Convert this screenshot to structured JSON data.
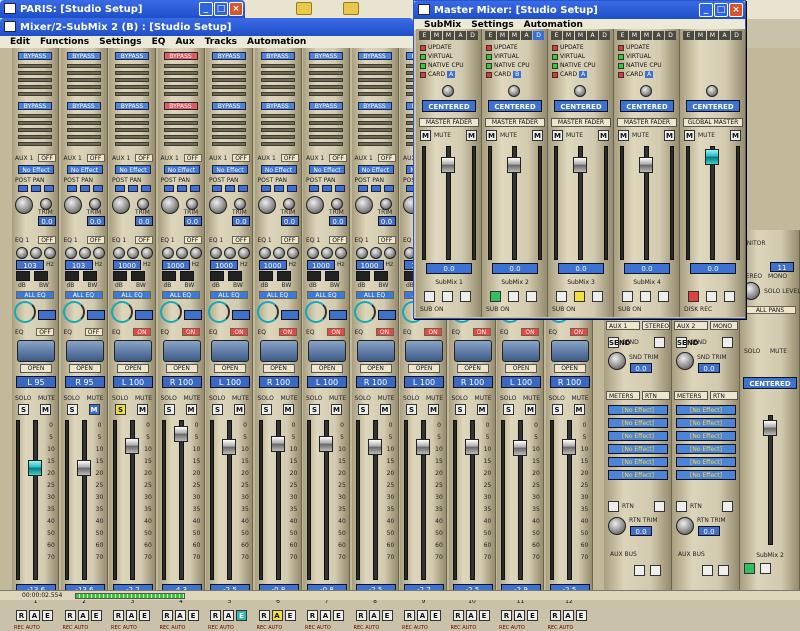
{
  "desktop": {
    "paris_title": "PARIS: [Studio Setup]"
  },
  "mixer_window": {
    "title": "Mixer/2-SubMix 2 (B) : [Studio Setup]",
    "menu": [
      "Edit",
      "Functions",
      "Settings",
      "EQ",
      "Aux",
      "Tracks",
      "Automation"
    ]
  },
  "labels": {
    "bypass": "BYPASS",
    "aux1": "AUX 1",
    "off": "OFF",
    "on": "ON",
    "no_effect": "No Effect",
    "post_pan": "POST PAN",
    "trim": "TRIM",
    "eq1": "EQ 1",
    "eq": "EQ",
    "hz": "Hz",
    "db": "dB",
    "bw": "BW",
    "all_eq": "ALL EQ",
    "open": "OPEN",
    "solo": "SOLO",
    "mute": "MUTE",
    "rec": "REC",
    "auto": "AUTO",
    "r": "R",
    "a": "A",
    "e": "E",
    "s": "S",
    "m": "M",
    "trim_vals": [
      "0.0",
      "0.0",
      "0.0",
      "0.0",
      "0.0",
      "0.0",
      "0.0",
      "0.0"
    ],
    "freq_vals": [
      "103",
      "103",
      "1000",
      "1000",
      "1000",
      "1000",
      "1000",
      "1000"
    ]
  },
  "channels": [
    {
      "num": "1",
      "pan": "L 95",
      "fader": "-13.6",
      "eq_state": "OFF",
      "bypass_red": false,
      "solo_active": false
    },
    {
      "num": "2",
      "pan": "R 95",
      "fader": "-13.6",
      "eq_state": "OFF",
      "bypass_red": false,
      "solo_active": false
    },
    {
      "num": "3",
      "pan": "L 100",
      "fader": "-2.2",
      "eq_state": "ON",
      "bypass_red": false,
      "solo_active": true
    },
    {
      "num": "4",
      "pan": "R 100",
      "fader": "4.3",
      "eq_state": "ON",
      "bypass_red": true,
      "solo_active": false
    },
    {
      "num": "5",
      "pan": "L 100",
      "fader": "-2.5",
      "eq_state": "ON",
      "bypass_red": false,
      "solo_active": false
    },
    {
      "num": "6",
      "pan": "R 100",
      "fader": "-0.8",
      "eq_state": "ON",
      "bypass_red": false,
      "solo_active": false
    },
    {
      "num": "7",
      "pan": "L 100",
      "fader": "-0.8",
      "eq_state": "ON",
      "bypass_red": false,
      "solo_active": false
    },
    {
      "num": "8",
      "pan": "R 100",
      "fader": "-2.5",
      "eq_state": "ON",
      "bypass_red": false,
      "solo_active": false
    },
    {
      "num": "9",
      "pan": "L 100",
      "fader": "-2.7",
      "eq_state": "ON",
      "bypass_red": false,
      "solo_active": false
    },
    {
      "num": "10",
      "pan": "R 100",
      "fader": "-2.5",
      "eq_state": "ON",
      "bypass_red": false,
      "solo_active": false
    },
    {
      "num": "11",
      "pan": "L 100",
      "fader": "-2.9",
      "eq_state": "ON",
      "bypass_red": false,
      "solo_active": false
    },
    {
      "num": "12",
      "pan": "R 100",
      "fader": "-2.5",
      "eq_state": "ON",
      "bypass_red": false,
      "solo_active": false
    }
  ],
  "fader_scale": [
    "0",
    "5",
    "10",
    "15",
    "20",
    "25",
    "30",
    "35",
    "40",
    "50",
    "60",
    "70"
  ],
  "master_window": {
    "title": "Master Mixer: [Studio Setup]",
    "menu": [
      "SubMix",
      "Settings",
      "Automation"
    ],
    "options": [
      "UPDATE",
      "VIRTUAL",
      "NATIVE",
      "CARD"
    ],
    "cpu": "CPU",
    "centered": "CENTERED",
    "master_fader": "MASTER FADER",
    "global_master": "GLOBAL MASTER",
    "emmad": [
      "E",
      "M",
      "M",
      "A",
      "D"
    ],
    "fader_val": "0.0",
    "sub_on": "SUB ON",
    "disk_rec": "DISK REC",
    "submixes": [
      "SubMix 1",
      "SubMix 2",
      "SubMix 3",
      "SubMix 4"
    ],
    "card_vals": [
      "A",
      "B",
      "A",
      "A"
    ]
  },
  "right_panel": {
    "aux1_stereo": "AUX 1",
    "stereo": "STEREO",
    "aux2_mono": "AUX 2",
    "mono": "MONO",
    "send": "SEND",
    "snd_trim": "SND TRIM",
    "meters": "METERS",
    "rtn": "RTN",
    "no_effect": "[No Effect]",
    "rtn_trim": "RTN TRIM",
    "val": "0.0",
    "aux_bus": "AUX BUS",
    "monitor": "ONITOR",
    "stereo_label": "TEREO",
    "mono_label": "MONO",
    "solo_level": "SOLO LEVEL",
    "all_pans": "ALL PANS",
    "centered": "CENTERED",
    "submix2": "SubMix 2",
    "master_fader": "MASTER FADER",
    "solo": "SOLO",
    "mute": "MUTE",
    "level_val": "11"
  },
  "status": {
    "time": "00:00:02.554"
  }
}
